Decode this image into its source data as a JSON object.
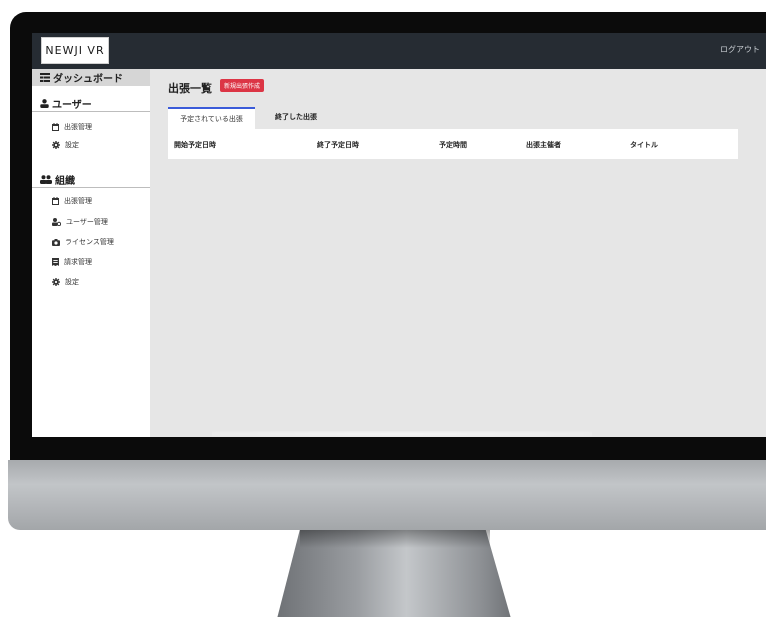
{
  "app": {
    "logo": "NEWJI VR",
    "logout": "ログアウト"
  },
  "sidebar": {
    "dashboard": "ダッシュボード",
    "user_section": {
      "title": "ユーザー",
      "items": [
        {
          "label": "出張管理",
          "icon": "calendar-icon"
        },
        {
          "label": "設定",
          "icon": "gear-icon"
        }
      ]
    },
    "org_section": {
      "title": "組織",
      "items": [
        {
          "label": "出張管理",
          "icon": "calendar-icon"
        },
        {
          "label": "ユーザー管理",
          "icon": "user-gear-icon"
        },
        {
          "label": "ライセンス管理",
          "icon": "camera-icon"
        },
        {
          "label": "請求管理",
          "icon": "invoice-icon"
        },
        {
          "label": "設定",
          "icon": "gear-icon"
        }
      ]
    }
  },
  "main": {
    "title": "出張一覧",
    "new_button": "新規出張作成",
    "tabs": [
      "予定されている出張",
      "終了した出張"
    ],
    "active_tab": 0,
    "columns": [
      "開始予定日時",
      "終了予定日時",
      "予定時間",
      "出張主催者",
      "タイトル"
    ],
    "rows": []
  },
  "colors": {
    "topbar": "#262c33",
    "accent": "#3b5bd9",
    "danger": "#dc3545",
    "content_bg": "#e6e6e6"
  }
}
